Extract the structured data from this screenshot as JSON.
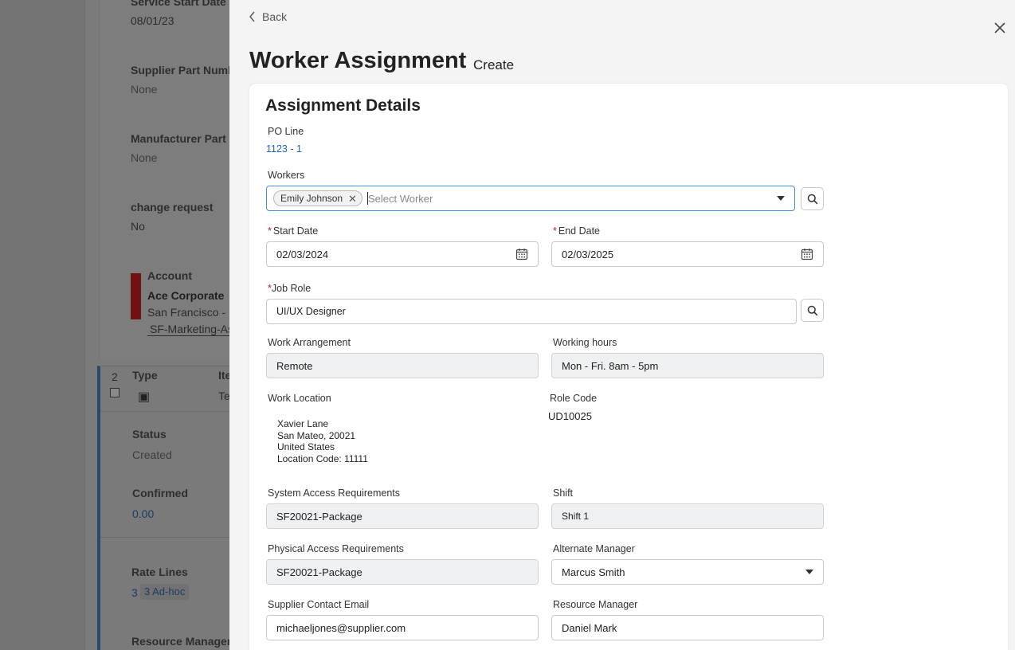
{
  "background": {
    "service_start_date": {
      "label": "Service Start Date",
      "value": "08/01/23"
    },
    "supplier_part_number": {
      "label": "Supplier Part Numb",
      "value": "None"
    },
    "manufacturer_part": {
      "label": "Manufacturer Part",
      "value": "None"
    },
    "change_request": {
      "label": "change request",
      "value": "No"
    },
    "account": {
      "label": "Account",
      "name": "Ace Corporate",
      "location": "San Francisco - I",
      "link": "SF-Marketing-As"
    },
    "line": {
      "number": "2",
      "type_label": "Type",
      "item_label": "Ite",
      "item_value": "Te",
      "status_label": "Status",
      "status_value": "Created",
      "confirmed_label": "Confirmed",
      "confirmed_value": "0.00",
      "rate_lines_label": "Rate Lines",
      "rate_lines_count": "3",
      "rate_lines_badge": "3 Ad-hoc",
      "resource_manager_label": "Resource Manager"
    }
  },
  "modal": {
    "back_label": "Back",
    "title": "Worker Assignment",
    "subtitle": "Create",
    "section_title": "Assignment Details",
    "po_line": {
      "label": "PO Line",
      "value": "1123 - 1"
    },
    "workers": {
      "label": "Workers",
      "selected": "Emily Johnson",
      "placeholder": "Select Worker"
    },
    "start_date": {
      "label": "Start Date",
      "value": "02/03/2024"
    },
    "end_date": {
      "label": "End Date",
      "value": "02/03/2025"
    },
    "job_role": {
      "label": "Job Role",
      "value": "UI/UX Designer"
    },
    "work_arrangement": {
      "label": "Work Arrangement",
      "value": "Remote"
    },
    "working_hours": {
      "label": "Working hours",
      "value": "Mon - Fri. 8am - 5pm"
    },
    "work_location": {
      "label": "Work Location",
      "line1": "Xavier Lane",
      "line2": "San Mateo, 20021",
      "line3": "United States",
      "line4": "Location Code: 11111"
    },
    "role_code": {
      "label": "Role Code",
      "value": "UD10025"
    },
    "system_access": {
      "label": "System Access Requirements",
      "value": "SF20021-Package"
    },
    "shift": {
      "label": "Shift",
      "value": "Shift 1"
    },
    "physical_access": {
      "label": "Physical Access Requirements",
      "value": "SF20021-Package"
    },
    "alternate_manager": {
      "label": "Alternate Manager",
      "value": "Marcus Smith"
    },
    "supplier_contact_email": {
      "label": "Supplier Contact Email",
      "value": "michaeljones@supplier.com"
    },
    "resource_manager": {
      "label": "Resource Manager",
      "value": "Daniel Mark"
    }
  },
  "colors": {
    "link": "#1b66b8",
    "required": "#c0172a",
    "overlay": "#7a7a7a",
    "account_bar": "#6e1212"
  }
}
